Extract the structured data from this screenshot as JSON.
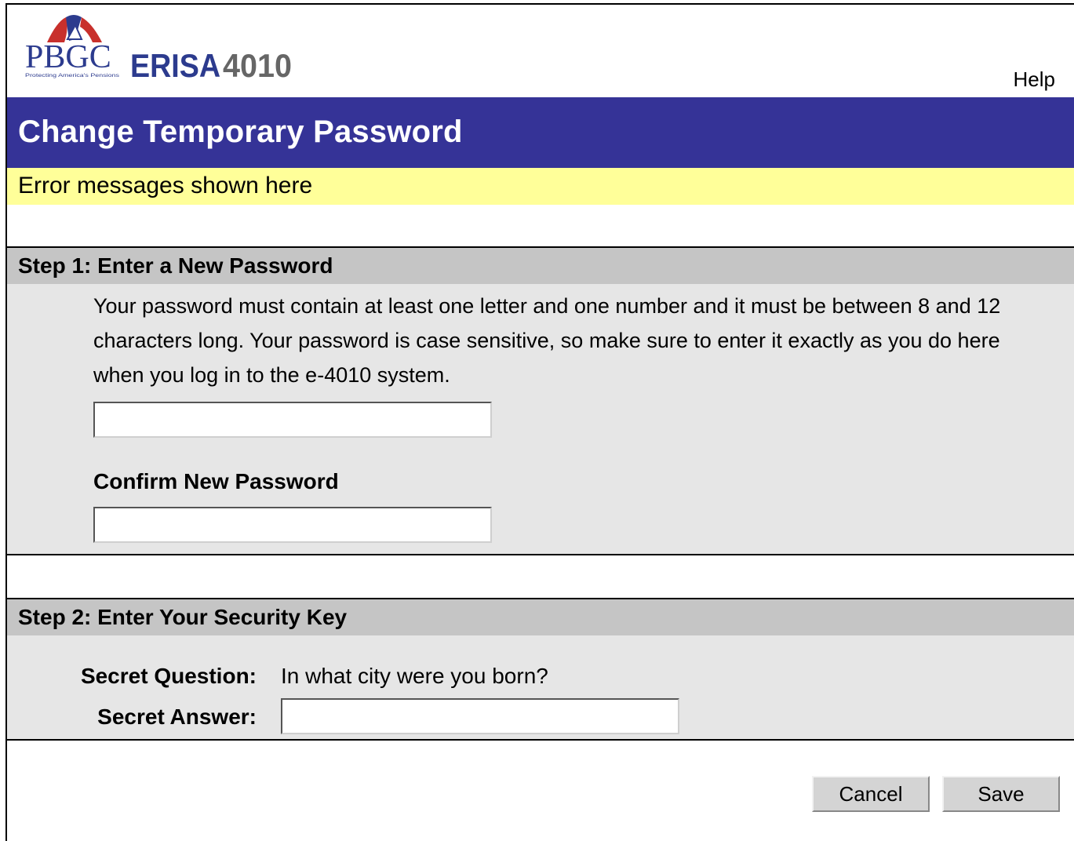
{
  "logo": {
    "pbgc": "PBGC",
    "erisa": "ERISA",
    "number": "4010",
    "tagline": "Protecting America's Pensions"
  },
  "header": {
    "help_label": "Help"
  },
  "page": {
    "title": "Change Temporary Password",
    "error_message": "Error messages shown here"
  },
  "step1": {
    "title": "Step 1: Enter a New Password",
    "instructions": "Your password must contain at least one letter and one number and it must be between 8 and 12  characters long. Your password is case sensitive, so make sure to enter it exactly as you do here  when you log in to the e-4010 system.",
    "new_password_value": "",
    "confirm_label": "Confirm New Password",
    "confirm_password_value": ""
  },
  "step2": {
    "title": "Step 2: Enter Your Security Key",
    "question_label": "Secret Question:",
    "question_value": "In what city were you born?",
    "answer_label": "Secret Answer:",
    "answer_value": ""
  },
  "buttons": {
    "cancel": "Cancel",
    "save": "Save"
  },
  "colors": {
    "title_bar": "#353397",
    "error_bar": "#ffff99",
    "section_bg": "#e6e6e6",
    "section_header": "#c5c5c5",
    "logo_red": "#c8302c",
    "logo_blue": "#2c3b8e"
  }
}
